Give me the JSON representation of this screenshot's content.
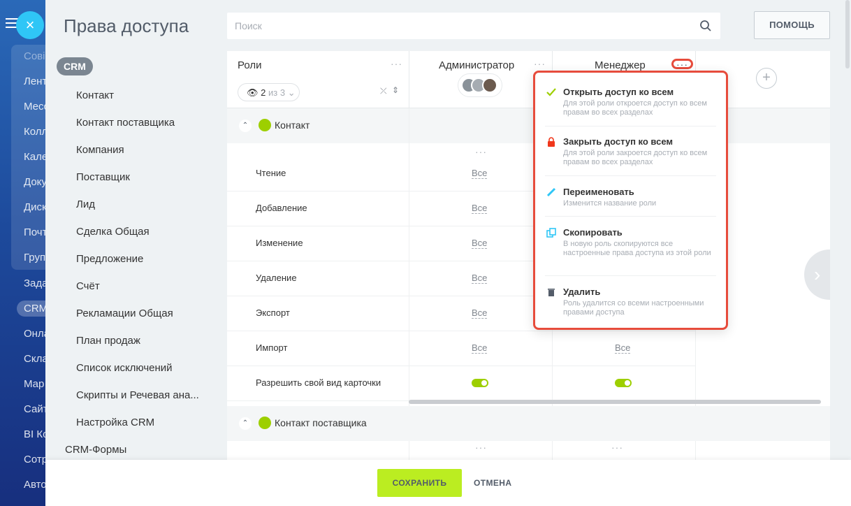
{
  "portal_menu": {
    "items": [
      "Сові",
      "Лент",
      "Месс",
      "Колл",
      "Кале",
      "Доку",
      "Диск",
      "Почт",
      "Груп",
      "Зада",
      "CRM",
      "Онла",
      "Скла",
      "Мар",
      "Сайт",
      "BI Ко",
      "Сотр",
      "Авто"
    ],
    "close_icon": "×"
  },
  "header": {
    "title": "Права доступа",
    "search_placeholder": "Поиск",
    "help_label": "ПОМОЩЬ"
  },
  "nav": {
    "badge": "CRM",
    "items": [
      "Контакт",
      "Контакт поставщика",
      "Компания",
      "Поставщик",
      "Лид",
      "Сделка Общая",
      "Предложение",
      "Счёт",
      "Рекламации Общая",
      "План продаж",
      "Список исключений",
      "Скрипты и Речевая ана...",
      "Настройка CRM"
    ],
    "bottom_item": "CRM-Формы"
  },
  "table": {
    "roles_label": "Роли",
    "roles_count": "2",
    "roles_of": "из 3",
    "roles": [
      {
        "name": "Администратор"
      },
      {
        "name": "Менеджер"
      }
    ],
    "sections": [
      {
        "label": "Контакт"
      },
      {
        "label": "Контакт поставщика"
      }
    ],
    "rows": [
      {
        "name": "Чтение",
        "admin": "Все",
        "manager": ""
      },
      {
        "name": "Добавление",
        "admin": "Все",
        "manager": ""
      },
      {
        "name": "Изменение",
        "admin": "Все",
        "manager": ""
      },
      {
        "name": "Удаление",
        "admin": "Все",
        "manager": ""
      },
      {
        "name": "Экспорт",
        "admin": "Все",
        "manager": ""
      },
      {
        "name": "Импорт",
        "admin": "Все",
        "manager": "Все"
      },
      {
        "name": "Разрешить свой вид карточки",
        "admin": "toggle-on",
        "manager": "toggle-on"
      }
    ]
  },
  "popup": {
    "items": [
      {
        "icon": "check-icon",
        "title": "Открыть доступ ко всем",
        "desc": "Для этой роли откроется доступ ко всем правам во всех разделах"
      },
      {
        "icon": "lock-icon",
        "title": "Закрыть доступ ко всем",
        "desc": "Для этой роли закроется доступ ко всем правам во всех разделах"
      },
      {
        "icon": "pencil-icon",
        "title": "Переименовать",
        "desc": "Изменится название роли"
      },
      {
        "icon": "copy-icon",
        "title": "Скопировать",
        "desc": "В новую роль скопируются все настроенные права доступа из этой роли"
      },
      {
        "icon": "trash-icon",
        "title": "Удалить",
        "desc": "Роль удалится со всеми настроенными правами доступа"
      }
    ]
  },
  "footer": {
    "save_label": "СОХРАНИТЬ",
    "cancel_label": "ОТМЕНА"
  },
  "colors": {
    "accent_green": "#bbed21",
    "toggle_green": "#9dcf00",
    "highlight_red": "#e74c3c",
    "close_blue": "#2fc6f6"
  }
}
